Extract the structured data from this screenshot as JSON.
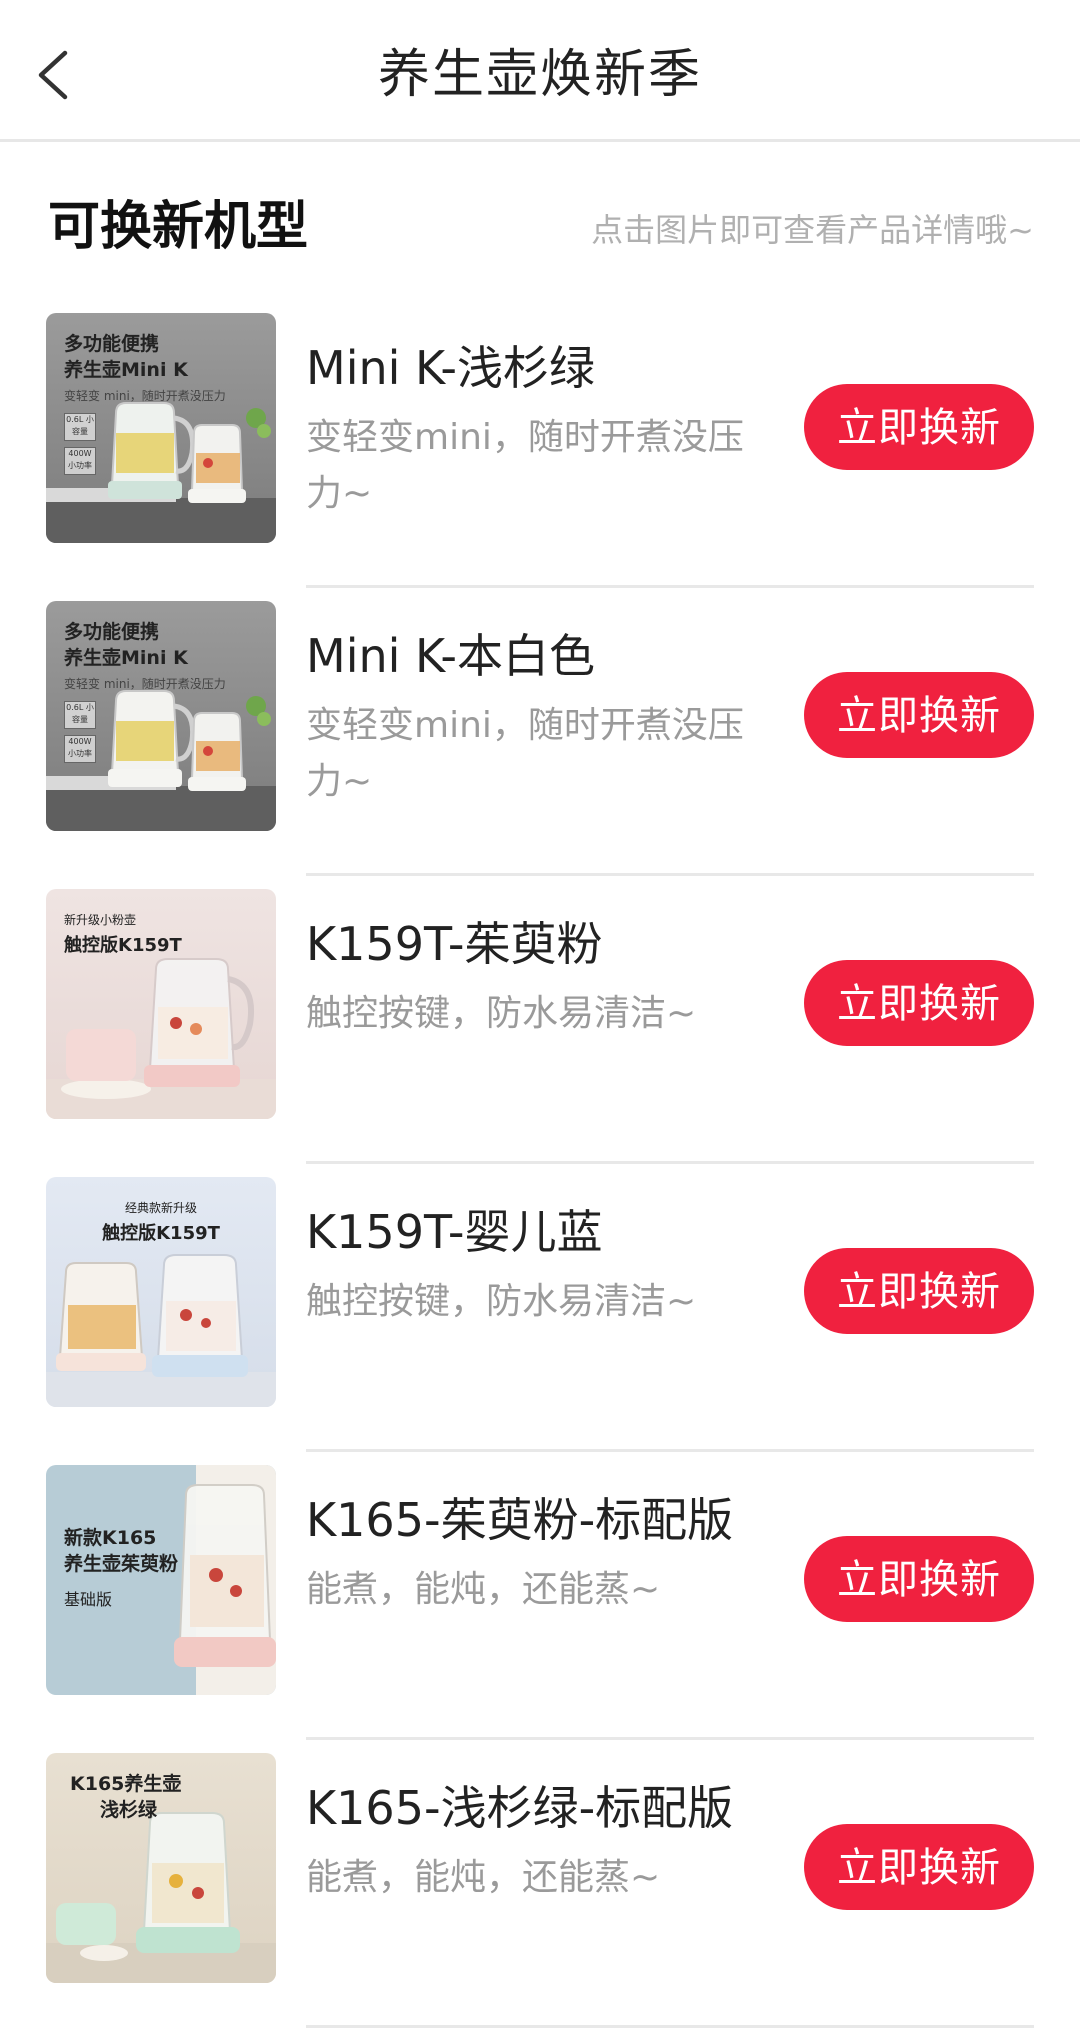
{
  "header": {
    "title": "养生壶焕新季",
    "back_icon": "chevron-left-icon"
  },
  "section": {
    "title": "可换新机型",
    "hint": "点击图片即可查看产品详情哦~"
  },
  "colors": {
    "accent": "#f0213f",
    "divider": "#e8e8e8",
    "muted_text": "#9a9a9a"
  },
  "products": [
    {
      "name": "Mini K-浅杉绿",
      "desc": "变轻变mini，随时开煮没压力~",
      "button": "立即换新",
      "thumb": {
        "line1": "多功能便携",
        "line2": "养生壶Mini K",
        "sub": "变轻变 mini，随时开煮没压力",
        "badge1": "0.6L 小容量",
        "badge2": "400W 小功率"
      }
    },
    {
      "name": "Mini K-本白色",
      "desc": "变轻变mini，随时开煮没压力~",
      "button": "立即换新",
      "thumb": {
        "line1": "多功能便携",
        "line2": "养生壶Mini K",
        "sub": "变轻变 mini，随时开煮没压力",
        "badge1": "0.6L 小容量",
        "badge2": "400W 小功率"
      }
    },
    {
      "name": "K159T-茱萸粉",
      "desc": "触控按键，防水易清洁~",
      "button": "立即换新",
      "thumb": {
        "line1": "新升级小粉壶",
        "line2": "触控版K159T"
      }
    },
    {
      "name": "K159T-婴儿蓝",
      "desc": "触控按键，防水易清洁~",
      "button": "立即换新",
      "thumb": {
        "line1": "经典款新升级",
        "line2": "触控版K159T"
      }
    },
    {
      "name": "K165-茱萸粉-标配版",
      "desc": "能煮，能炖，还能蒸~",
      "button": "立即换新",
      "thumb": {
        "line1": "新款K165",
        "line2": "养生壶茱萸粉",
        "sub": "基础版"
      }
    },
    {
      "name": "K165-浅杉绿-标配版",
      "desc": "能煮，能炖，还能蒸~",
      "button": "立即换新",
      "thumb": {
        "line1": "K165养生壶",
        "line2": "浅杉绿"
      }
    }
  ]
}
